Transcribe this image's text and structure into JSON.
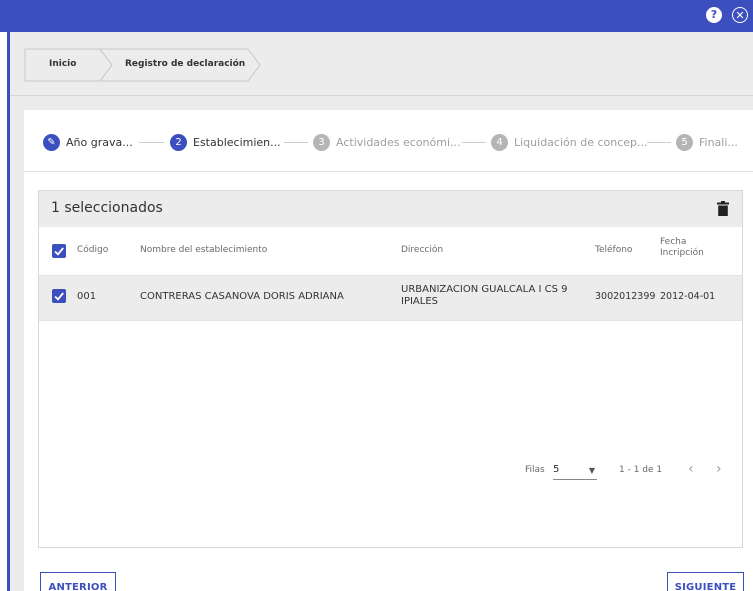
{
  "window": {
    "help_icon_glyph": "?",
    "close_icon_glyph": "✕",
    "accent_color": "#3b4fbf"
  },
  "breadcrumb": {
    "items": [
      {
        "label": "Inicio"
      },
      {
        "label": "Registro de declaración"
      }
    ]
  },
  "stepper": {
    "steps": [
      {
        "number": "✎",
        "label": "Año grava...",
        "state": "completed"
      },
      {
        "number": "2",
        "label": "Establecimien...",
        "state": "active"
      },
      {
        "number": "3",
        "label": "Actividades económi...",
        "state": "inactive"
      },
      {
        "number": "4",
        "label": "Liquidación de concep...",
        "state": "inactive"
      },
      {
        "number": "5",
        "label": "Finali...",
        "state": "inactive"
      }
    ]
  },
  "table": {
    "selection_text": "1 seleccionados",
    "columns": {
      "code": "Código",
      "name": "Nombre del establecimiento",
      "address": "Dirección",
      "phone": "Teléfono",
      "date_line1": "Fecha",
      "date_line2": "Incripción"
    },
    "rows": [
      {
        "selected": true,
        "code": "001",
        "name": "CONTRERAS CASANOVA DORIS ADRIANA",
        "address_line1": "URBANIZACION GUALCALA I CS 9",
        "address_line2": "IPIALES",
        "phone": "3002012399",
        "date": "2012-04-01"
      }
    ],
    "pagination": {
      "rows_label": "Filas",
      "rows_value": "5",
      "range_text": "1 - 1 de 1"
    }
  },
  "actions": {
    "back_label": "ANTERIOR",
    "next_label": "SIGUIENTE"
  }
}
